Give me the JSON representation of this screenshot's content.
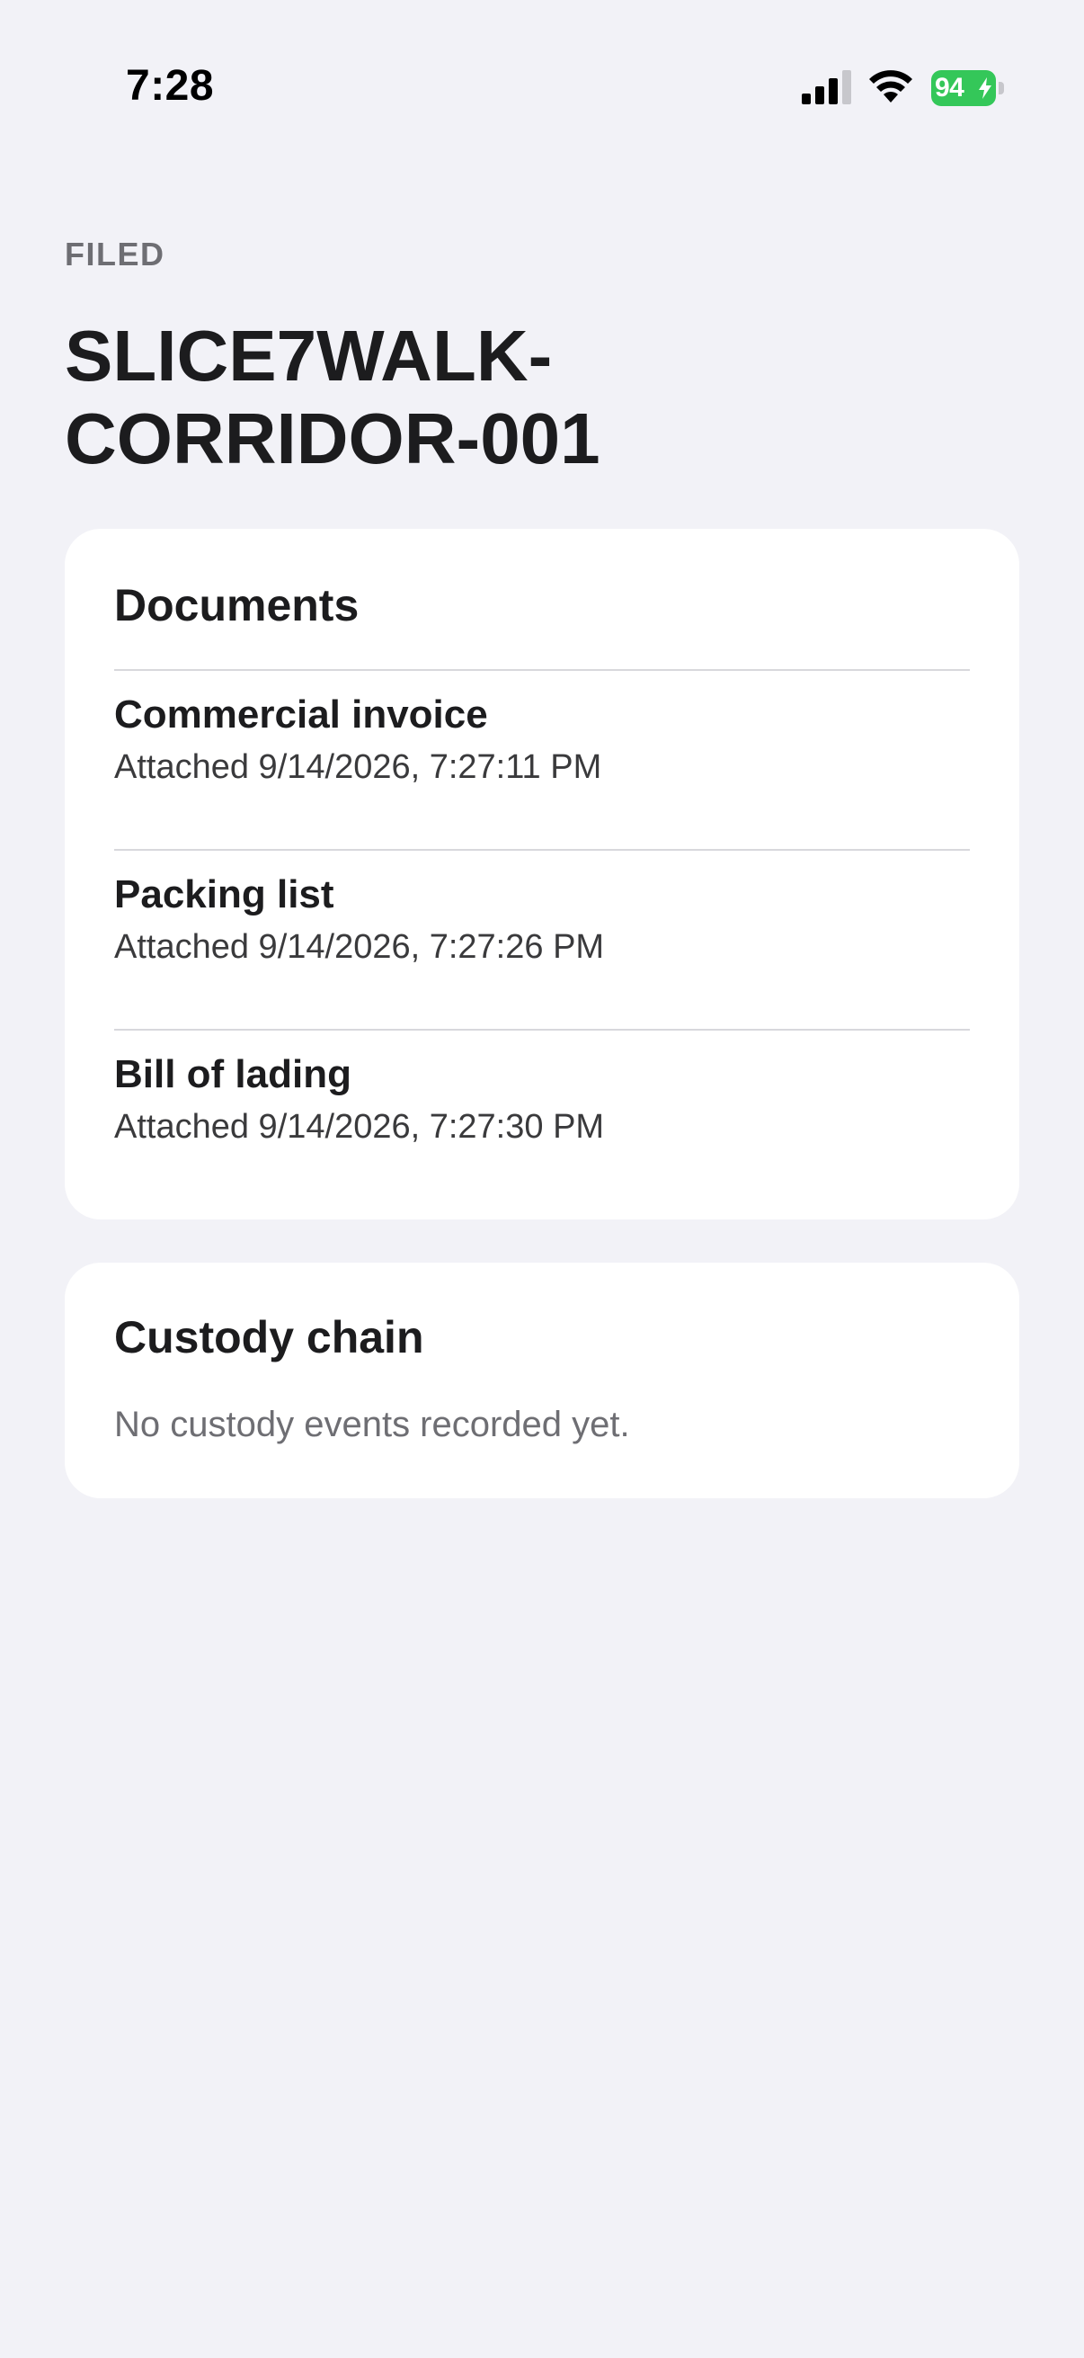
{
  "status_bar": {
    "time": "7:28",
    "battery_percent": "94",
    "icons": [
      "cellular-signal-icon",
      "wifi-icon",
      "battery-charging-icon"
    ]
  },
  "header": {
    "eyebrow": "FILED",
    "title": "SLICE7WALK-CORRIDOR-001"
  },
  "documents": {
    "title": "Documents",
    "items": [
      {
        "name": "Commercial invoice",
        "meta": "Attached 9/14/2026, 7:27:11 PM"
      },
      {
        "name": "Packing list",
        "meta": "Attached 9/14/2026, 7:27:26 PM"
      },
      {
        "name": "Bill of lading",
        "meta": "Attached 9/14/2026, 7:27:30 PM"
      }
    ]
  },
  "custody": {
    "title": "Custody chain",
    "empty_message": "No custody events recorded yet."
  },
  "colors": {
    "background": "#f2f2f7",
    "card": "#ffffff",
    "battery": "#34c759",
    "secondary_text": "#6e6e73"
  }
}
